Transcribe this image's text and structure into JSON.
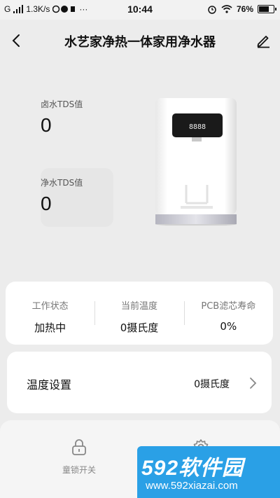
{
  "status_bar": {
    "carrier": "G",
    "speed": "1.3K/s",
    "time": "10:44",
    "battery": "76%",
    "battery_level": 0.76
  },
  "header": {
    "title": "水艺家净热一体家用净水器",
    "back_icon": "chevron-left-icon",
    "edit_icon": "edit-pencil-icon"
  },
  "tds": {
    "raw_label": "卤水TDS值",
    "raw_value": "0",
    "pure_label": "净水TDS值",
    "pure_value": "0"
  },
  "device": {
    "display_text": "8888"
  },
  "info": [
    {
      "label": "工作状态",
      "value": "加热中"
    },
    {
      "label": "当前温度",
      "value": "0摄氏度"
    },
    {
      "label": "PCB滤芯寿命",
      "value": "0%"
    }
  ],
  "temperature_setting": {
    "label": "温度设置",
    "value": "0摄氏度",
    "icon": "chevron-right-icon"
  },
  "bottom_bar": {
    "child_lock_label": "童锁开关",
    "child_lock_icon": "lock-icon",
    "settings_icon": "gear-icon"
  },
  "watermark": {
    "logo": "592软件园",
    "url": "www.592xiazai.com"
  },
  "colors": {
    "background": "#ececec",
    "card": "#ffffff",
    "watermark_blue": "#2aa0e6",
    "watermark_orange": "#ffb21a"
  }
}
